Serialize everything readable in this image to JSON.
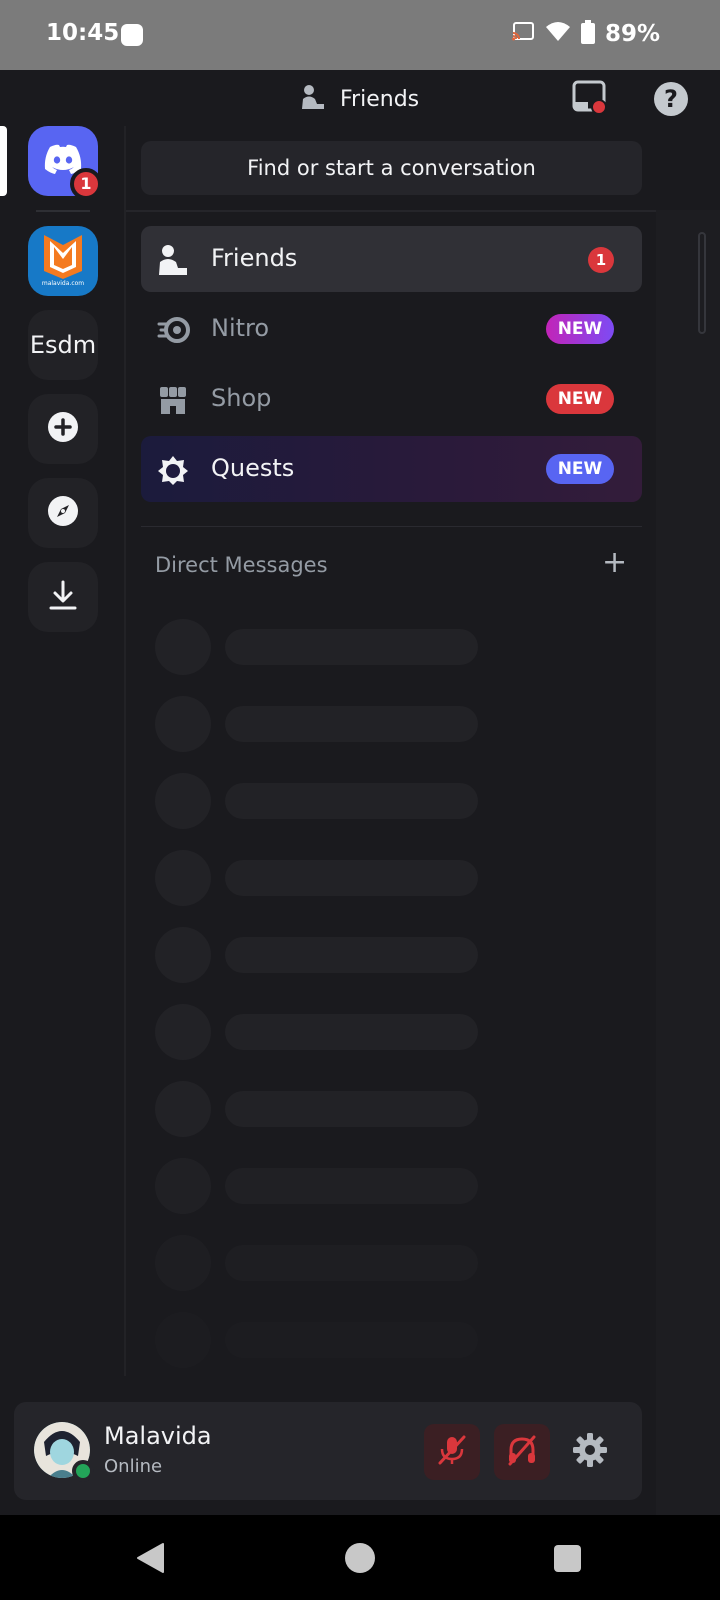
{
  "status_bar": {
    "time": "10:45",
    "battery": "89%",
    "icons": [
      "app-notification-icon",
      "cast-icon",
      "wifi-icon",
      "battery-icon"
    ]
  },
  "header": {
    "title": "Friends",
    "icons": [
      "friends-icon",
      "inbox-icon",
      "help-icon"
    ],
    "help_glyph": "?"
  },
  "server_rail": {
    "dm_badge": "1",
    "servers": [
      {
        "name": "Malavida",
        "icon": "malavida-logo-icon",
        "logo_text": "malavida.com"
      },
      {
        "name": "Esdm",
        "label": "Esdm"
      }
    ],
    "actions": [
      "add-server-icon",
      "explore-icon",
      "download-icon"
    ]
  },
  "search": {
    "placeholder": "Find or start a conversation"
  },
  "nav": {
    "items": [
      {
        "label": "Friends",
        "badge": "1",
        "icon": "friends-icon"
      },
      {
        "label": "Nitro",
        "badge": "NEW",
        "icon": "nitro-icon"
      },
      {
        "label": "Shop",
        "badge": "NEW",
        "icon": "shop-icon"
      },
      {
        "label": "Quests",
        "badge": "NEW",
        "icon": "quests-icon"
      }
    ]
  },
  "direct_messages": {
    "header": "Direct Messages",
    "add_glyph": "+"
  },
  "user": {
    "name": "Malavida",
    "status": "Online",
    "controls": [
      "mic-muted-icon",
      "deafen-icon",
      "settings-icon"
    ]
  },
  "colors": {
    "accent": "#5865f2",
    "danger": "#da373c",
    "online": "#23a559",
    "background": "#1a1a1e"
  }
}
